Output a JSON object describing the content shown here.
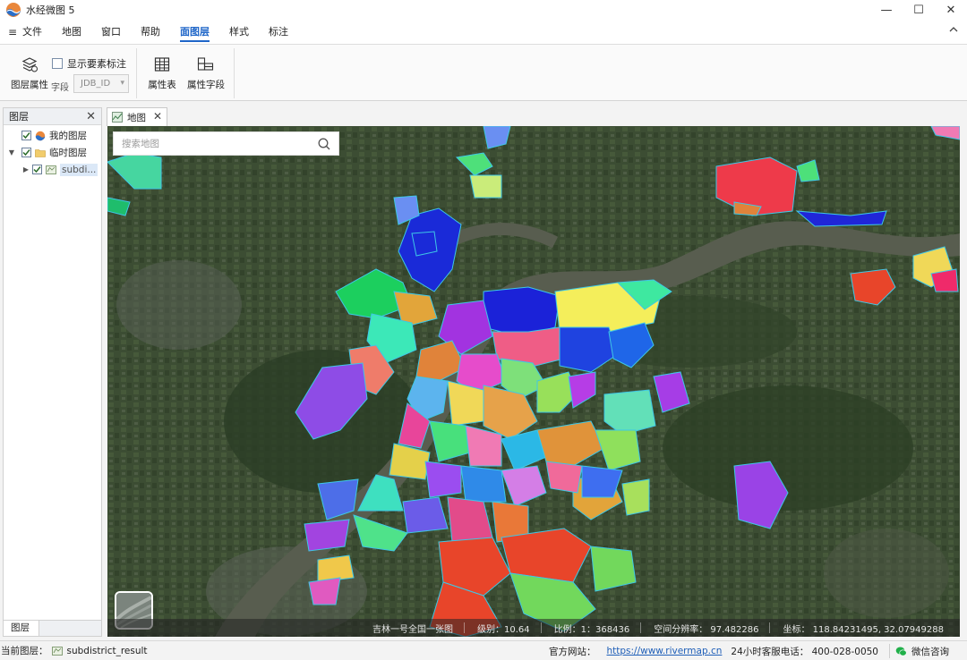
{
  "window": {
    "title": "水经微图 5",
    "minimize": "—",
    "maximize": "☐",
    "close": "✕"
  },
  "menu": {
    "items": [
      {
        "label": "文件"
      },
      {
        "label": "地图"
      },
      {
        "label": "窗口"
      },
      {
        "label": "帮助"
      },
      {
        "label": "面图层",
        "active": true
      },
      {
        "label": "样式"
      },
      {
        "label": "标注"
      }
    ]
  },
  "ribbon": {
    "layer_props_label": "图层属性",
    "show_labels_checkbox": "显示要素标注",
    "show_labels_checked": false,
    "field_label": "字段",
    "field_value": "JDB_ID",
    "attr_table_label": "属性表",
    "attr_field_label": "属性字段"
  },
  "layer_panel": {
    "title": "图层",
    "bottom_tab": "图层",
    "tree": [
      {
        "label": "我的图层",
        "checked": true,
        "icon": "globe-icon"
      },
      {
        "label": "临时图层",
        "checked": true,
        "icon": "folder-icon",
        "expanded": true
      },
      {
        "label": "subdi...",
        "checked": true,
        "icon": "polygon-layer-icon",
        "selected": true
      }
    ]
  },
  "map_tab": {
    "label": "地图"
  },
  "map": {
    "search_placeholder": "搜索地图",
    "status": {
      "source": "吉林一号全国一张图",
      "level": "级别：10.64",
      "scale": "比例：1：368436",
      "resolution": "空间分辨率：  97.482286",
      "coords": "坐标：  118.84231495, 32.07949288"
    }
  },
  "statusbar": {
    "current_layer_label": "当前图层：",
    "current_layer": "subdistrict_result",
    "website_label": "官方网站：",
    "website_url": "https://www.rivermap.cn",
    "hotline": "24小时客服电话：  400-028-0050",
    "wechat": "微信咨询"
  },
  "colors": {
    "accent": "#1f66c8",
    "link": "#1f5fb8",
    "river": "#585d4f",
    "map_ground": "#3a4a31"
  }
}
